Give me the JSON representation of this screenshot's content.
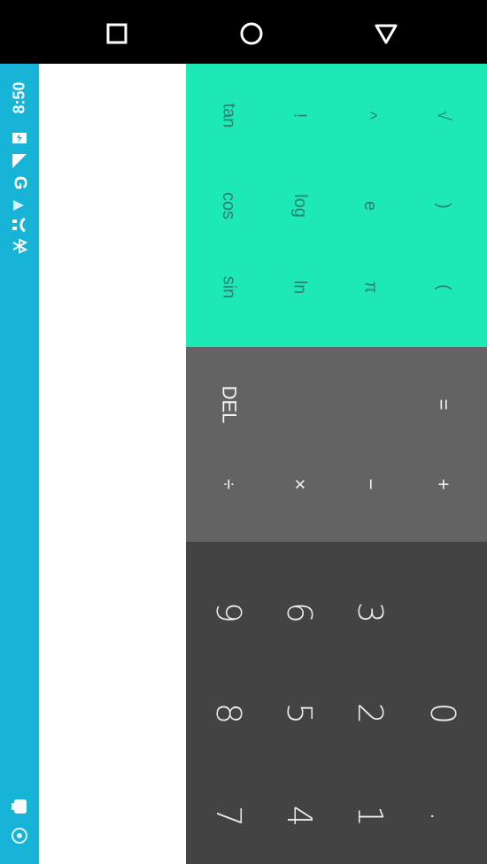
{
  "nav": {
    "recents_icon": "square-icon",
    "home_icon": "circle-icon",
    "back_icon": "triangle-icon"
  },
  "status_bar": {
    "time": "8:50",
    "network": "G",
    "icons": [
      "bluetooth-icon",
      "headset-icon",
      "wifi-icon",
      "signal-icon",
      "battery-icon"
    ],
    "bottom_icons": [
      "android-icon",
      "chrome-icon"
    ]
  },
  "display": {
    "expression": "",
    "result": ""
  },
  "advanced": {
    "rows": [
      [
        "sin",
        "cos",
        "tan"
      ],
      [
        "ln",
        "log",
        "!"
      ],
      [
        "π",
        "e",
        "^"
      ],
      [
        "(",
        ")",
        "√"
      ]
    ]
  },
  "operators": {
    "del": "DEL",
    "divide": "÷",
    "multiply": "×",
    "minus": "−",
    "plus": "+",
    "equals": "="
  },
  "digits": {
    "rows": [
      [
        "7",
        "8",
        "9"
      ],
      [
        "4",
        "5",
        "6"
      ],
      [
        "1",
        "2",
        "3"
      ],
      [
        ".",
        "0",
        ""
      ]
    ]
  },
  "colors": {
    "status": "#17b4d8",
    "advanced_bg": "#1de9b6",
    "advanced_text": "#2f7f6c",
    "ops_bg": "#636363",
    "digits_bg": "#434343"
  }
}
